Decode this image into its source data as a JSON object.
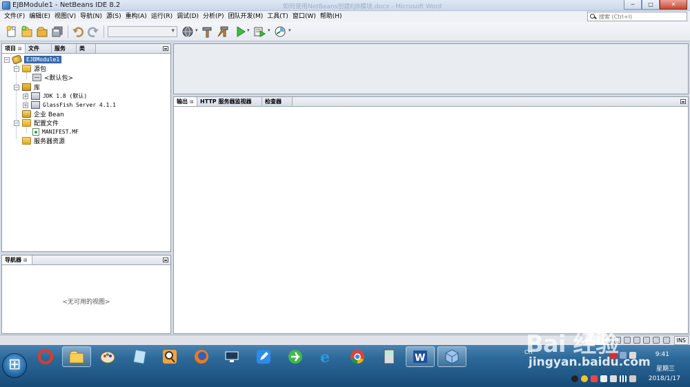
{
  "window": {
    "title": "EJBModule1 - NetBeans IDE 8.2",
    "ghost_title": "如何使用NetBeans创建EJB模块.docx - Microsoft Word",
    "controls": [
      "─",
      "□",
      "✕"
    ]
  },
  "menu": {
    "items": [
      "文件(F)",
      "编辑(E)",
      "视图(V)",
      "导航(N)",
      "源(S)",
      "重构(A)",
      "运行(R)",
      "调试(D)",
      "分析(P)",
      "团队开发(M)",
      "工具(T)",
      "窗口(W)",
      "帮助(H)"
    ]
  },
  "search": {
    "placeholder": "搜索 (Ctrl+I)"
  },
  "toolbar": {
    "buttons": [
      "new-file",
      "new-project",
      "open-project",
      "save-all",
      "undo",
      "redo",
      "config-select",
      "globe",
      "build",
      "clean-build",
      "run",
      "debug",
      "profile"
    ],
    "config_value": ""
  },
  "projects_panel": {
    "tabs": [
      "项目",
      "文件",
      "服务",
      "类"
    ],
    "close_mark": "⊠",
    "tree": [
      {
        "label": "EJBModule1",
        "level": 0,
        "icon": "ejb-module-icon",
        "expanded": true,
        "selected": true
      },
      {
        "label": "源包",
        "level": 1,
        "icon": "folder-icon",
        "expanded": true
      },
      {
        "label": "<默认包>",
        "level": 2,
        "icon": "package-icon"
      },
      {
        "label": "库",
        "level": 1,
        "icon": "library-icon",
        "expanded": true
      },
      {
        "label": "JDK 1.8 (默认)",
        "level": 2,
        "icon": "jar-icon",
        "expanded": false
      },
      {
        "label": "GlassFish Server 4.1.1",
        "level": 2,
        "icon": "jar-icon",
        "expanded": false
      },
      {
        "label": "企业 Bean",
        "level": 1,
        "icon": "bean-icon"
      },
      {
        "label": "配置文件",
        "level": 1,
        "icon": "folder-icon",
        "expanded": true
      },
      {
        "label": "MANIFEST.MF",
        "level": 2,
        "icon": "manifest-file-icon"
      },
      {
        "label": "服务器资源",
        "level": 1,
        "icon": "folder-icon"
      }
    ]
  },
  "navigator_panel": {
    "tab": "导航器",
    "empty_text": "<无可用的视图>"
  },
  "output_panel": {
    "tabs": [
      "输出",
      "HTTP 服务器监视器",
      "检查器"
    ]
  },
  "status": {
    "ins": "INS"
  },
  "taskbar": {
    "apps": [
      "sogou-browser",
      "file-explorer",
      "paint",
      "notes",
      "search-tool",
      "firefox",
      "media-player",
      "sticky-app",
      "360-browser",
      "internet-explorer",
      "chrome",
      "calculator",
      "word",
      "netbeans"
    ],
    "lang": "CH",
    "clock_time": "9:41",
    "clock_day": "星期三",
    "clock_date": "2018/1/17"
  },
  "watermark": {
    "big": "Bai  经验",
    "small": "jingyan.baidu.com"
  }
}
